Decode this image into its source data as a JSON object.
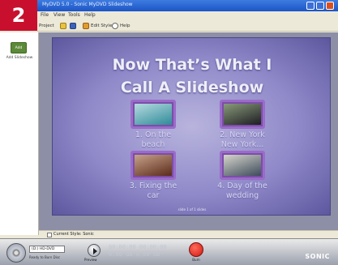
{
  "badge": {
    "step": "2"
  },
  "window": {
    "title": "MyDVD 5.0 - Sonic MyDVD Slideshow",
    "menu": [
      "File",
      "View",
      "Tools",
      "Help"
    ],
    "toolbar": {
      "new_label": "Project",
      "edit_style_label": "Edit Style",
      "help_label": "Help"
    }
  },
  "sidebar": {
    "add_button_label": "Add",
    "add_slideshow_label": "Add Slideshow"
  },
  "slide": {
    "title_line1": "Now That’s What I",
    "title_line2": "Call A Slideshow",
    "thumbnails": [
      {
        "caption_l1": "1. On the",
        "caption_l2": "beach",
        "colors": [
          "#2e8a98",
          "#b7dbe0"
        ]
      },
      {
        "caption_l1": "2. New York",
        "caption_l2": "New York...",
        "colors": [
          "#1c1c22",
          "#8a9b7a"
        ]
      },
      {
        "caption_l1": "3. Fixing the",
        "caption_l2": "car",
        "colors": [
          "#5a2a1a",
          "#c8a38a"
        ]
      },
      {
        "caption_l1": "4. Day of the",
        "caption_l2": "wedding",
        "colors": [
          "#3c4a5a",
          "#d7d6cc"
        ]
      }
    ],
    "footer_text": "slide 1 of 1 slides"
  },
  "status": {
    "current_style": "Current Style: Sonic"
  },
  "bottombar": {
    "drive_select": "(D:) HD-DVD",
    "drive_status": "Ready to Burn Disc",
    "preview_label": "Preview",
    "readout_left": "00:00:00  00:00:00",
    "readout_right": "0.00 GB  0.00 GB",
    "record_label": "Burn",
    "brand": "SONIC"
  },
  "colors": {
    "badge": "#c8102e",
    "slide_bg": "#8f89c9",
    "thumb_frame": "#9a6bc9",
    "record": "#d01a12"
  }
}
